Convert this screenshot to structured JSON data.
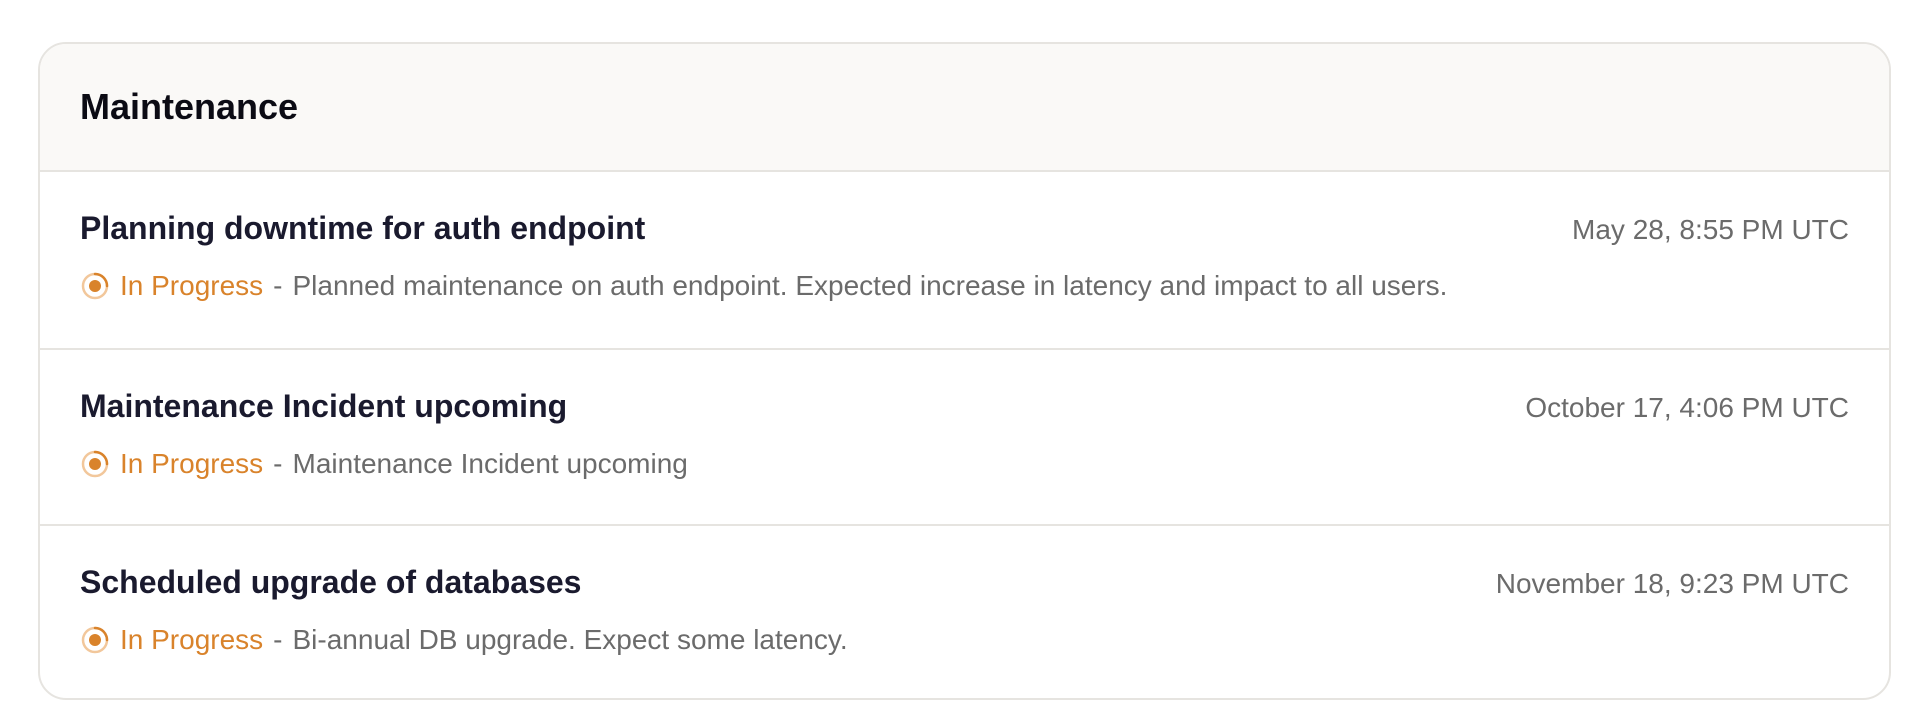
{
  "panel": {
    "title": "Maintenance"
  },
  "colors": {
    "status_in_progress": "#d9832b",
    "muted_text": "#6b6b6b",
    "title_text": "#1a1a2e",
    "header_bg": "#faf9f7",
    "border": "#e6e4e0"
  },
  "items": [
    {
      "title": "Planning downtime for auth endpoint",
      "date": "May 28, 8:55 PM UTC",
      "status": "In Progress",
      "separator": "-",
      "description": "Planned maintenance on auth endpoint. Expected increase in latency and impact to all users.",
      "icon": "in-progress-icon"
    },
    {
      "title": "Maintenance Incident upcoming",
      "date": "October 17, 4:06 PM UTC",
      "status": "In Progress",
      "separator": "-",
      "description": "Maintenance Incident upcoming",
      "icon": "in-progress-icon"
    },
    {
      "title": "Scheduled upgrade of databases",
      "date": "November 18, 9:23 PM UTC",
      "status": "In Progress",
      "separator": "-",
      "description": "Bi-annual DB upgrade. Expect some latency.",
      "icon": "in-progress-icon"
    }
  ]
}
